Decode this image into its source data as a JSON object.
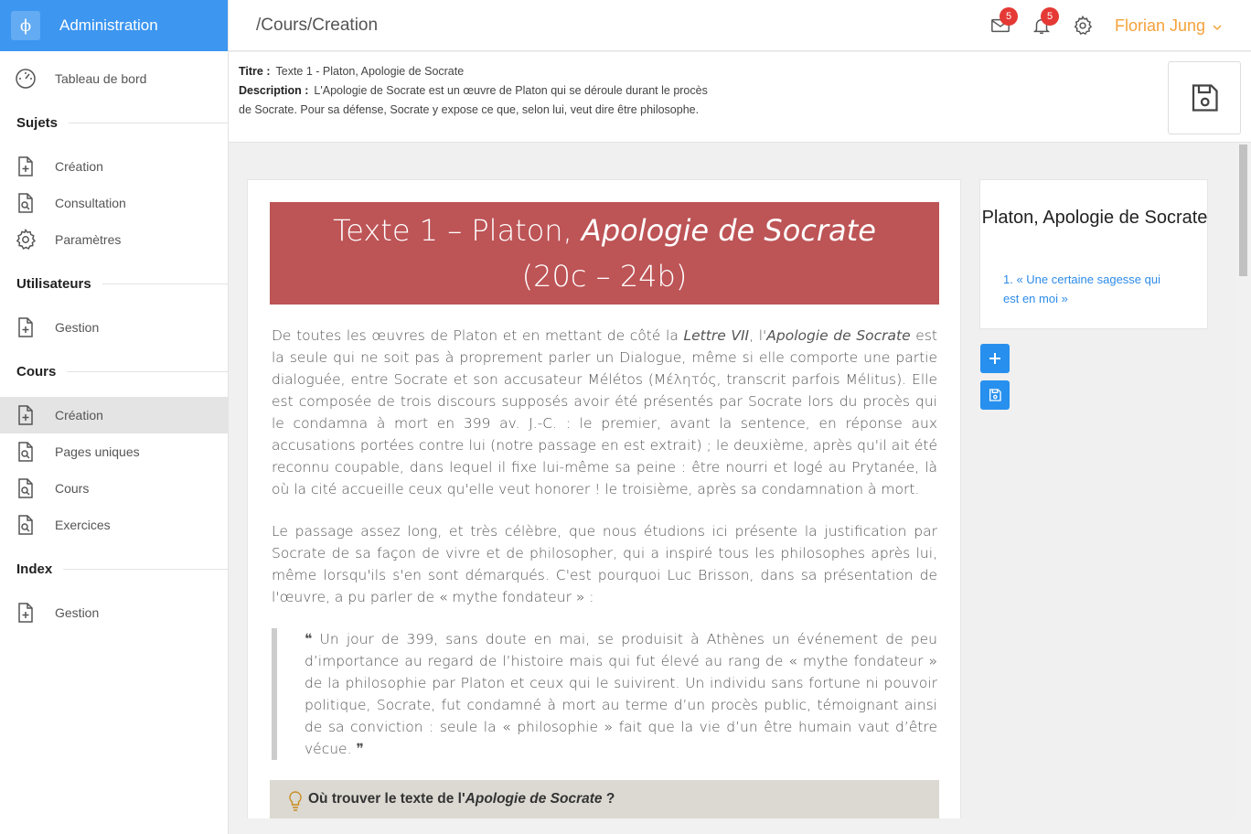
{
  "brand": {
    "logo_glyph": "ϕ",
    "name": "Administration",
    "color": "#3d96f0"
  },
  "sidebar": {
    "items": [
      {
        "label": "Tableau de bord",
        "icon": "dashboard-gauge-icon"
      },
      {
        "section": "Sujets"
      },
      {
        "label": "Création",
        "icon": "file-plus-icon"
      },
      {
        "label": "Consultation",
        "icon": "file-search-icon"
      },
      {
        "label": "Paramètres",
        "icon": "gear-icon"
      },
      {
        "section": "Utilisateurs"
      },
      {
        "label": "Gestion",
        "icon": "file-plus-icon"
      },
      {
        "section": "Cours"
      },
      {
        "label": "Création",
        "icon": "file-plus-icon",
        "active": true
      },
      {
        "label": "Pages uniques",
        "icon": "file-search-icon"
      },
      {
        "label": "Cours",
        "icon": "file-search-icon"
      },
      {
        "label": "Exercices",
        "icon": "file-search-icon"
      },
      {
        "section": "Index"
      },
      {
        "label": "Gestion",
        "icon": "file-plus-icon"
      }
    ]
  },
  "topbar": {
    "route": "/Cours/Creation",
    "mail_badge": "5",
    "notif_badge": "5",
    "user": "Florian Jung",
    "user_color": "#f5a23a"
  },
  "info": {
    "title_key": "Titre :",
    "title_value": "Texte 1 - Platon, Apologie de Socrate",
    "desc_key": "Description :",
    "desc_line1": "L'Apologie de Socrate est un œuvre de Platon qui se déroule durant le procès",
    "desc_line2": "de Socrate. Pour sa défense, Socrate y expose ce que, selon lui, veut dire être philosophe."
  },
  "content": {
    "hero_line1_pre": "Texte 1 – Platon, ",
    "hero_line1_em": "Apologie de Socrate",
    "hero_line2": "(20c – 24b)",
    "hero_color": "#bd5456",
    "p1_a": "De toutes les œuvres de Platon et en mettant de côté la ",
    "p1_em1": "Lettre VII",
    "p1_b": ", l'",
    "p1_em2": "Apologie de Socrate",
    "p1_c": " est la seule qui ne soit pas à proprement parler un Dialogue, même si elle comporte une partie dialoguée, entre Socrate et son accusateur Mélétos (Μέλητός, transcrit parfois Mélitus). Elle est composée de trois discours supposés avoir été présentés par Socrate lors du procès qui le condamna à mort en 399 av. J.-C. : le premier, avant la sentence, en réponse aux accusations portées contre lui (notre passage en est extrait) ; le deuxième, après qu'il ait été reconnu coupable, dans lequel il fixe lui-même sa peine : être nourri et logé au Prytanée, là où la cité accueille ceux qu'elle veut honorer ! le troisième, après sa condamnation à mort.",
    "p2": "Le passage assez long, et très célèbre, que nous étudions ici présente la justification par Socrate de sa façon de vivre et de philosopher, qui a inspiré tous les philosophes après lui, même lorsqu'ils s'en sont démarqués. C'est pourquoi Luc Brisson, dans sa présentation de l'œuvre, a pu parler de « mythe fondateur » :",
    "quote": "❝ Un jour de 399, sans doute en mai, se produisit à Athènes un événement de peu d’importance au regard de l’histoire mais qui fut élevé au rang de « mythe fondateur » de la philosophie par Platon et ceux qui le suivirent. Un individu sans fortune ni pouvoir politique, Socrate, fut condamné à mort au terme d’un procès public, témoignant ainsi de sa conviction : seule la « philosophie » fait que la vie d’un être humain vaut d’être vécue. ❞",
    "tip_pre": "Où trouver le texte de l'",
    "tip_em": "Apologie de Socrate",
    "tip_post": " ?"
  },
  "toc": {
    "title": "Platon, Apologie de Socrate",
    "link": "1. « Une certaine sagesse qui est en moi »"
  },
  "actions": {
    "add_icon": "plus-icon",
    "save_icon": "floppy-disk-icon"
  }
}
